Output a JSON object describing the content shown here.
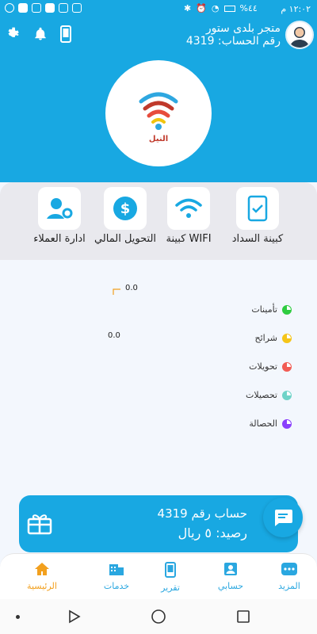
{
  "status_bar": {
    "time": "١٢:٠٢ م",
    "battery": "%٤٤"
  },
  "header": {
    "store_name": "متجر بلدى ستور",
    "account_number": "رقم الحساب: 4319",
    "logo_text": "النيل"
  },
  "services": [
    {
      "label": "كبينة السداد",
      "icon": "phone-check-icon"
    },
    {
      "label": "WIFI كبينة",
      "icon": "wifi-icon"
    },
    {
      "label": "التحويل المالي",
      "icon": "dollar-icon"
    },
    {
      "label": "ادارة العملاء",
      "icon": "users-gear-icon"
    }
  ],
  "stats": {
    "values": [
      "0.0",
      "0.0"
    ],
    "legend": [
      {
        "label": "تأمينات",
        "color": "#2ecc40"
      },
      {
        "label": "شرائح",
        "color": "#f5c518"
      },
      {
        "label": "تحويلات",
        "color": "#f25c54"
      },
      {
        "label": "تحصيلات",
        "color": "#6fd3c8"
      },
      {
        "label": "الحصالة",
        "color": "#8a3ffc"
      }
    ]
  },
  "balance_card": {
    "line1": "حساب رقم 4319",
    "line2": "رصيد: ٥ ريال"
  },
  "bottom_nav": [
    {
      "label": "المزيد",
      "icon": "more-icon"
    },
    {
      "label": "حسابي",
      "icon": "account-icon"
    },
    {
      "label": "تقرير",
      "icon": "report-icon"
    },
    {
      "label": "خدمات",
      "icon": "services-icon"
    },
    {
      "label": "الرئيسية",
      "icon": "home-icon",
      "active": true
    }
  ],
  "colors": {
    "primary": "#18a8e2",
    "active_nav": "#f2a01e"
  }
}
